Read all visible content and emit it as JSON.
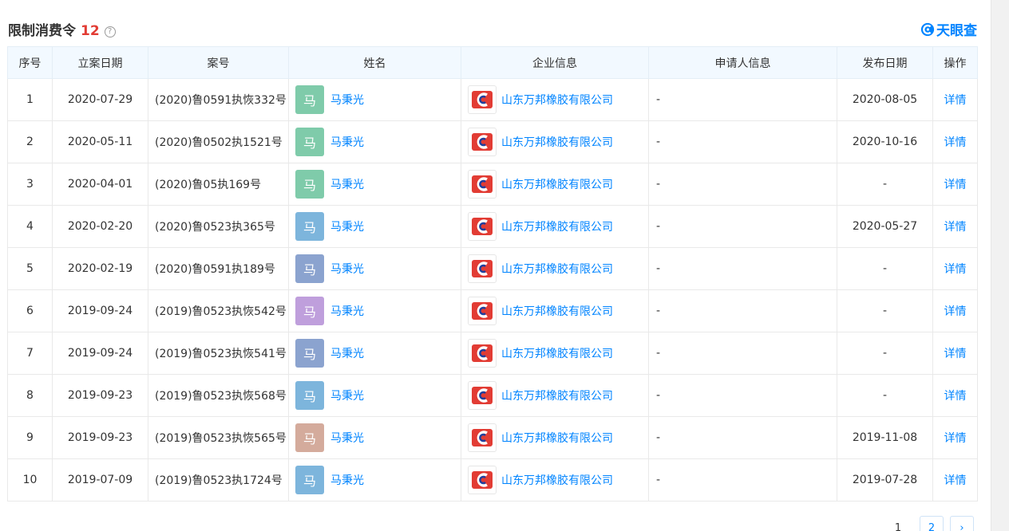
{
  "header": {
    "title": "限制消费令",
    "count": "12",
    "help_symbol": "?",
    "brand": "天眼查"
  },
  "table": {
    "columns": [
      "序号",
      "立案日期",
      "案号",
      "姓名",
      "企业信息",
      "申请人信息",
      "发布日期",
      "操作"
    ],
    "rows": [
      {
        "no": "1",
        "date": "2020-07-29",
        "case": "(2020)鲁0591执恢332号",
        "avatar": "马",
        "avatar_color": "#7fcbaa",
        "name": "马秉光",
        "company": "山东万邦橡胶有限公司",
        "applicant": "-",
        "publish": "2020-08-05",
        "action": "详情"
      },
      {
        "no": "2",
        "date": "2020-05-11",
        "case": "(2020)鲁0502执1521号",
        "avatar": "马",
        "avatar_color": "#7fcbaa",
        "name": "马秉光",
        "company": "山东万邦橡胶有限公司",
        "applicant": "-",
        "publish": "2020-10-16",
        "action": "详情"
      },
      {
        "no": "3",
        "date": "2020-04-01",
        "case": "(2020)鲁05执169号",
        "avatar": "马",
        "avatar_color": "#7fcbaa",
        "name": "马秉光",
        "company": "山东万邦橡胶有限公司",
        "applicant": "-",
        "publish": "-",
        "action": "详情"
      },
      {
        "no": "4",
        "date": "2020-02-20",
        "case": "(2020)鲁0523执365号",
        "avatar": "马",
        "avatar_color": "#7db5dc",
        "name": "马秉光",
        "company": "山东万邦橡胶有限公司",
        "applicant": "-",
        "publish": "2020-05-27",
        "action": "详情"
      },
      {
        "no": "5",
        "date": "2020-02-19",
        "case": "(2020)鲁0591执189号",
        "avatar": "马",
        "avatar_color": "#8ba3cf",
        "name": "马秉光",
        "company": "山东万邦橡胶有限公司",
        "applicant": "-",
        "publish": "-",
        "action": "详情"
      },
      {
        "no": "6",
        "date": "2019-09-24",
        "case": "(2019)鲁0523执恢542号",
        "avatar": "马",
        "avatar_color": "#bf9fdc",
        "name": "马秉光",
        "company": "山东万邦橡胶有限公司",
        "applicant": "-",
        "publish": "-",
        "action": "详情"
      },
      {
        "no": "7",
        "date": "2019-09-24",
        "case": "(2019)鲁0523执恢541号",
        "avatar": "马",
        "avatar_color": "#8ba3cf",
        "name": "马秉光",
        "company": "山东万邦橡胶有限公司",
        "applicant": "-",
        "publish": "-",
        "action": "详情"
      },
      {
        "no": "8",
        "date": "2019-09-23",
        "case": "(2019)鲁0523执恢568号",
        "avatar": "马",
        "avatar_color": "#7db5dc",
        "name": "马秉光",
        "company": "山东万邦橡胶有限公司",
        "applicant": "-",
        "publish": "-",
        "action": "详情"
      },
      {
        "no": "9",
        "date": "2019-09-23",
        "case": "(2019)鲁0523执恢565号",
        "avatar": "马",
        "avatar_color": "#d4ab9c",
        "name": "马秉光",
        "company": "山东万邦橡胶有限公司",
        "applicant": "-",
        "publish": "2019-11-08",
        "action": "详情"
      },
      {
        "no": "10",
        "date": "2019-07-09",
        "case": "(2019)鲁0523执1724号",
        "avatar": "马",
        "avatar_color": "#7db5dc",
        "name": "马秉光",
        "company": "山东万邦橡胶有限公司",
        "applicant": "-",
        "publish": "2019-07-28",
        "action": "详情"
      }
    ]
  },
  "pagination": {
    "current": "1",
    "next_page": "2",
    "next_symbol": "›"
  },
  "colors": {
    "accent": "#0084ff",
    "count": "#e23c34",
    "header_bg": "#f2f9ff"
  }
}
